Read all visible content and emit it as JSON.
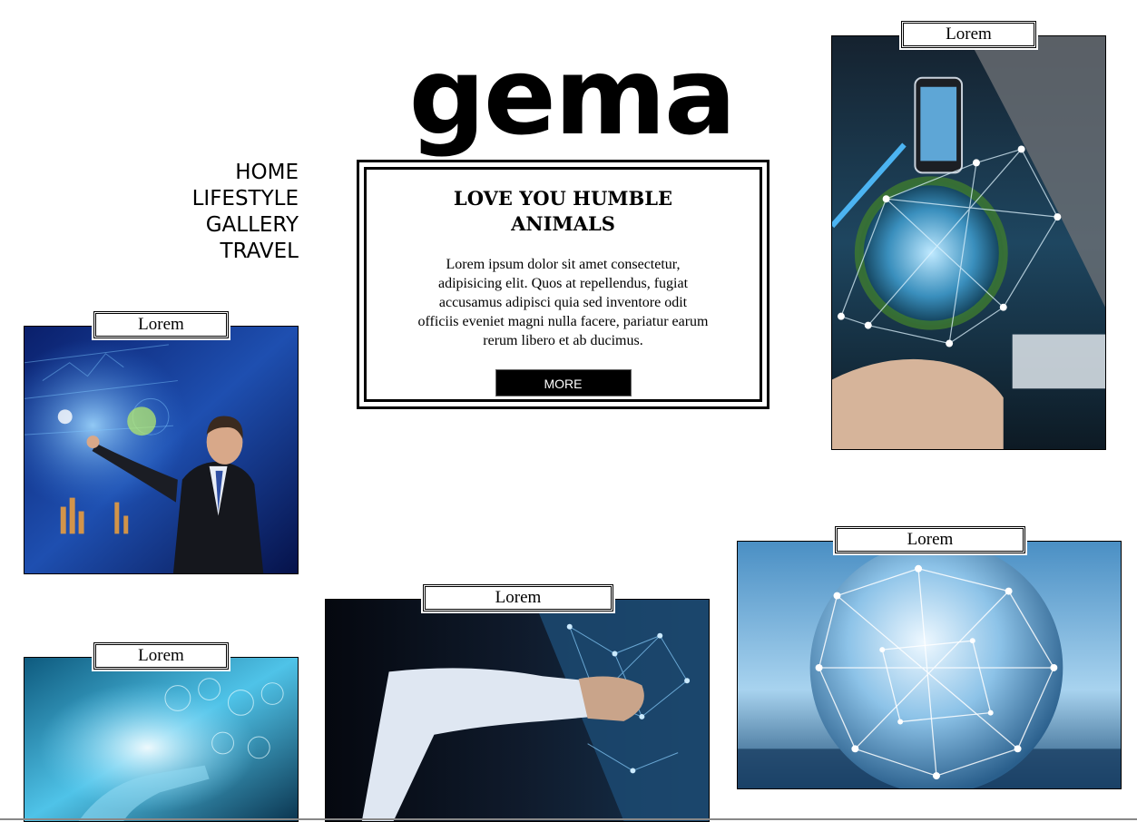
{
  "brand": {
    "logo_text": "gema"
  },
  "nav": {
    "items": [
      {
        "label": "HOME"
      },
      {
        "label": "LIFESTYLE"
      },
      {
        "label": "GALLERY"
      },
      {
        "label": "TRAVEL"
      }
    ]
  },
  "feature": {
    "title": "LOVE YOU HUMBLE ANIMALS",
    "body": "Lorem ipsum dolor sit amet consectetur, adipisicing elit. Quos at repellendus, fugiat accusamus adipisci quia sed inventore odit officiis eveniet magni nulla facere, pariatur earum rerum libero et ab ducimus.",
    "button_label": "MORE"
  },
  "cards": [
    {
      "label": "Lorem",
      "image": "businessman-touchscreen-image"
    },
    {
      "label": "Lorem",
      "image": "network-globe-hand-image"
    },
    {
      "label": "Lorem",
      "image": "digital-tech-hand-image"
    },
    {
      "label": "Lorem",
      "image": "tablet-network-image"
    },
    {
      "label": "Lorem",
      "image": "crystal-globe-image"
    }
  ],
  "colors": {
    "text": "#000000",
    "background": "#ffffff",
    "button_bg": "#000000",
    "button_text": "#ffffff"
  }
}
